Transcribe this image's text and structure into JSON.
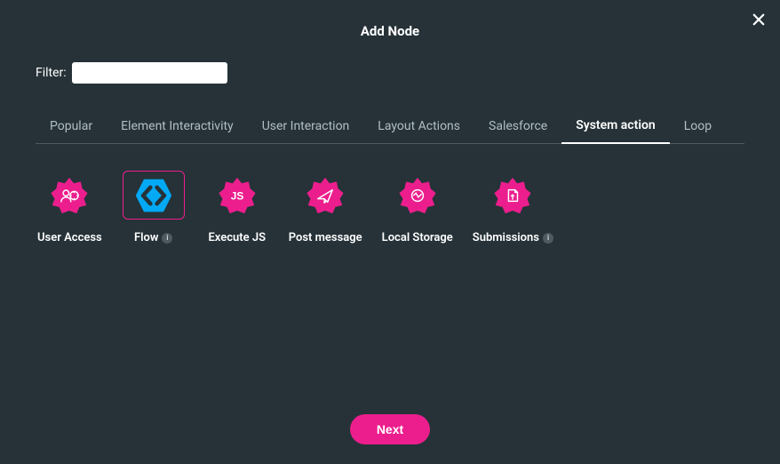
{
  "title": "Add Node",
  "filter": {
    "label": "Filter:",
    "value": "",
    "placeholder": ""
  },
  "tabs": [
    {
      "label": "Popular",
      "active": false
    },
    {
      "label": "Element Interactivity",
      "active": false
    },
    {
      "label": "User Interaction",
      "active": false
    },
    {
      "label": "Layout Actions",
      "active": false
    },
    {
      "label": "Salesforce",
      "active": false
    },
    {
      "label": "System action",
      "active": true
    },
    {
      "label": "Loop",
      "active": false
    }
  ],
  "nodes": [
    {
      "id": "user-access",
      "label": "User Access",
      "icon": "user-access",
      "selected": false,
      "info": false
    },
    {
      "id": "flow",
      "label": "Flow",
      "icon": "flow",
      "selected": true,
      "info": true
    },
    {
      "id": "execute-js",
      "label": "Execute JS",
      "icon": "js",
      "selected": false,
      "info": false
    },
    {
      "id": "post-message",
      "label": "Post message",
      "icon": "send",
      "selected": false,
      "info": false
    },
    {
      "id": "local-storage",
      "label": "Local Storage",
      "icon": "storage",
      "selected": false,
      "info": false
    },
    {
      "id": "submissions",
      "label": "Submissions",
      "icon": "doc",
      "selected": false,
      "info": true
    }
  ],
  "buttons": {
    "next": "Next"
  },
  "colors": {
    "accent": "#ec1e8d",
    "bg": "#263238",
    "hex": "#03a9f4"
  }
}
